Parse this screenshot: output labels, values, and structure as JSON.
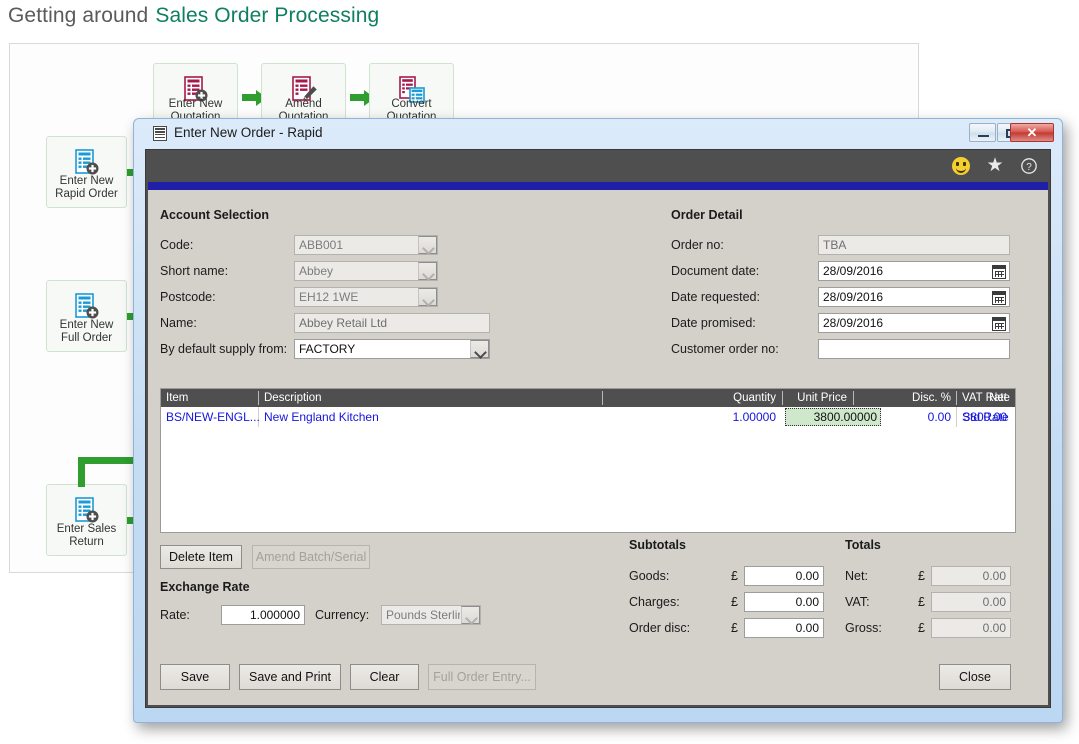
{
  "page": {
    "heading_prefix": "Getting around",
    "heading_title": "Sales Order Processing",
    "accent_green": "#0f7f5f",
    "arrow_green": "#2f9e2f"
  },
  "diagram": {
    "top_nodes": [
      {
        "label_line1": "Enter New",
        "label_line2": "Quotation",
        "icon": "new-quotation-icon"
      },
      {
        "label_line1": "Amend",
        "label_line2": "Quotation",
        "icon": "amend-quotation-icon"
      },
      {
        "label_line1": "Convert",
        "label_line2": "Quotation",
        "icon": "convert-quotation-icon"
      }
    ],
    "side_nodes": [
      {
        "label_line1": "Enter New",
        "label_line2": "Rapid Order",
        "icon": "new-rapid-order-icon"
      },
      {
        "label_line1": "Enter New",
        "label_line2": "Full Order",
        "icon": "new-full-order-icon"
      },
      {
        "label_line1": "Enter Sales",
        "label_line2": "Return",
        "icon": "sales-return-icon"
      }
    ]
  },
  "dialog": {
    "title": "Enter New Order - Rapid",
    "title_icon": "grid-document-icon",
    "window_controls": {
      "minimize": "minimize-icon",
      "maximize": "maximize-icon",
      "close": "✕"
    },
    "toolbar_icons": [
      {
        "name": "smiley-icon",
        "glyph": ""
      },
      {
        "name": "favourite-star-icon",
        "glyph": "★"
      },
      {
        "name": "help-icon",
        "glyph": "?"
      }
    ],
    "accent_bar_color": "#1f1fa8",
    "toolbar_bg": "#4f4f4f"
  },
  "account_selection": {
    "title": "Account Selection",
    "fields": [
      {
        "label": "Code:",
        "value": "ABB001",
        "type": "combo-readonly"
      },
      {
        "label": "Short name:",
        "value": "Abbey",
        "type": "combo-readonly"
      },
      {
        "label": "Postcode:",
        "value": "EH12 1WE",
        "type": "combo-readonly"
      },
      {
        "label": "Name:",
        "value": "Abbey Retail Ltd",
        "type": "text-readonly"
      },
      {
        "label": "By default supply from:",
        "value": "FACTORY",
        "type": "combo"
      }
    ]
  },
  "order_detail": {
    "title": "Order Detail",
    "fields": [
      {
        "label": "Order no:",
        "value": "TBA",
        "type": "text-readonly"
      },
      {
        "label": "Document date:",
        "value": "28/09/2016",
        "type": "date"
      },
      {
        "label": "Date requested:",
        "value": "28/09/2016",
        "type": "date"
      },
      {
        "label": "Date promised:",
        "value": "28/09/2016",
        "type": "date"
      },
      {
        "label": "Customer order no:",
        "value": "",
        "type": "text"
      }
    ]
  },
  "grid": {
    "columns": [
      "Item",
      "Description",
      "Quantity",
      "Unit Price",
      "Disc. %",
      "VAT Rate",
      "Net"
    ],
    "rows": [
      {
        "item": "BS/NEW-ENGL...",
        "description": "New England Kitchen",
        "quantity": "1.00000",
        "unit_price": "3800.00000",
        "disc_pct": "0.00",
        "vat_rate": "Std Rate",
        "net": "3800.00"
      }
    ],
    "selected_cell": "unit_price",
    "selected_cell_color": "#cfe8cc"
  },
  "item_actions": {
    "delete_item": "Delete Item",
    "amend_batch_serial": "Amend Batch/Serial",
    "amend_batch_serial_disabled": true
  },
  "exchange_rate": {
    "title": "Exchange Rate",
    "rate_label": "Rate:",
    "rate_value": "1.000000",
    "currency_label": "Currency:",
    "currency_value": "Pounds Sterling"
  },
  "subtotals": {
    "title": "Subtotals",
    "currency_symbol": "£",
    "rows": [
      {
        "label": "Goods:",
        "value": "0.00"
      },
      {
        "label": "Charges:",
        "value": "0.00"
      },
      {
        "label": "Order disc:",
        "value": "0.00"
      }
    ]
  },
  "totals": {
    "title": "Totals",
    "currency_symbol": "£",
    "rows": [
      {
        "label": "Net:",
        "value": "0.00"
      },
      {
        "label": "VAT:",
        "value": "0.00"
      },
      {
        "label": "Gross:",
        "value": "0.00"
      }
    ]
  },
  "footer_buttons": {
    "save": "Save",
    "save_and_print": "Save and Print",
    "clear": "Clear",
    "full_order_entry": "Full Order Entry...",
    "full_order_entry_disabled": true,
    "close": "Close"
  }
}
